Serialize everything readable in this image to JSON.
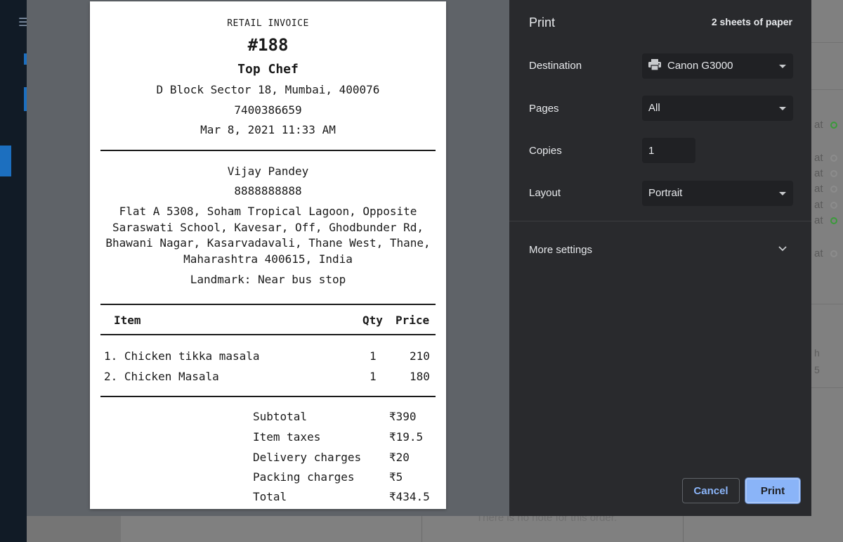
{
  "background": {
    "note_text": "There is no note for this order.",
    "right_rows": [
      "at",
      "at",
      "at",
      "at",
      "at",
      "at",
      "at"
    ],
    "right_ghost": [
      "h",
      "5"
    ]
  },
  "invoice": {
    "kind": "RETAIL INVOICE",
    "number": "#188",
    "shop_name": "Top Chef",
    "shop_address": "D Block Sector 18, Mumbai, 400076",
    "shop_phone": "7400386659",
    "date": "Mar 8, 2021 11:33 AM",
    "customer": {
      "name": "Vijay Pandey",
      "phone": "8888888888",
      "address": "Flat A 5308, Soham Tropical Lagoon, Opposite Saraswati School, Kavesar, Off, Ghodbunder Rd, Bhawani Nagar, Kasarvadavali, Thane West, Thane, Maharashtra 400615, India",
      "landmark": "Landmark: Near bus stop"
    },
    "columns": {
      "item": "Item",
      "qty": "Qty",
      "price": "Price"
    },
    "items": [
      {
        "name": "1. Chicken tikka masala",
        "qty": "1",
        "price": "210"
      },
      {
        "name": "2. Chicken Masala",
        "qty": "1",
        "price": "180"
      }
    ],
    "summary": [
      {
        "label": "Subtotal",
        "value": "₹390"
      },
      {
        "label": "Item taxes",
        "value": "₹19.5"
      },
      {
        "label": "Delivery charges",
        "value": "₹20"
      },
      {
        "label": "Packing charges",
        "value": "₹5"
      },
      {
        "label": "Total",
        "value": "₹434.5"
      }
    ]
  },
  "print_panel": {
    "title": "Print",
    "sheets": "2 sheets of paper",
    "destination_label": "Destination",
    "destination_value": "Canon G3000",
    "pages_label": "Pages",
    "pages_value": "All",
    "copies_label": "Copies",
    "copies_value": "1",
    "layout_label": "Layout",
    "layout_value": "Portrait",
    "more_settings": "More settings",
    "cancel_label": "Cancel",
    "print_label": "Print"
  },
  "colors": {
    "panel_bg": "#292a2d",
    "accent": "#8ab4f8",
    "preview_bg": "#5f6368"
  }
}
